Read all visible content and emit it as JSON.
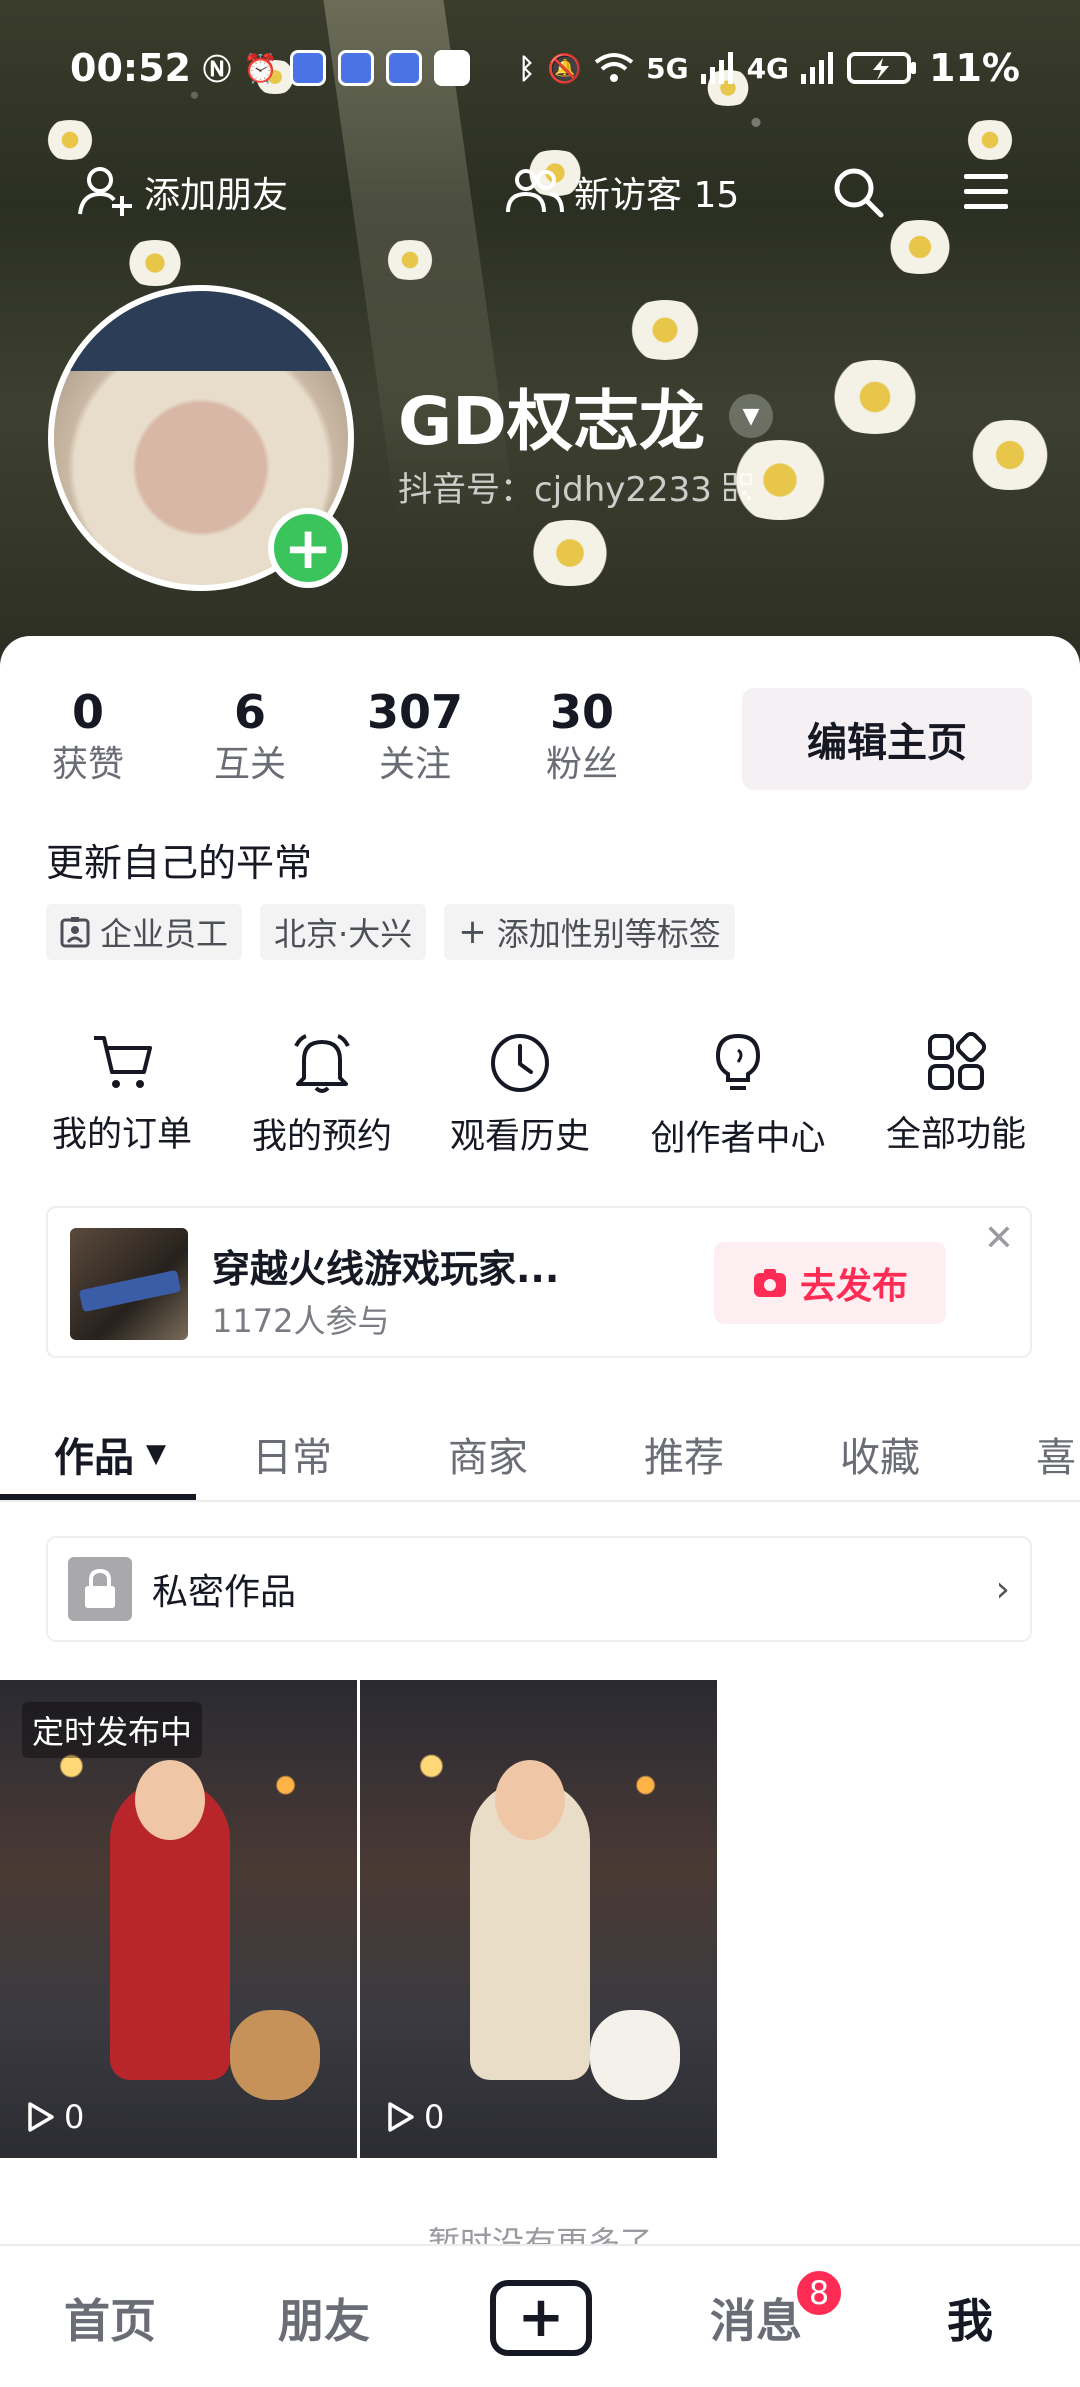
{
  "status_bar": {
    "time": "00:52",
    "network_5g": "5G",
    "network_4g": "4G",
    "battery": "11%"
  },
  "top_actions": {
    "add_friend": "添加朋友",
    "new_visitors": "新访客 15"
  },
  "profile": {
    "nickname": "GD权志龙",
    "douyin_id": "抖音号：cjdhy2233"
  },
  "stats": [
    {
      "value": "0",
      "label": "获赞"
    },
    {
      "value": "6",
      "label": "互关"
    },
    {
      "value": "307",
      "label": "关注"
    },
    {
      "value": "30",
      "label": "粉丝"
    }
  ],
  "edit_profile": "编辑主页",
  "bio": "更新自己的平常",
  "tags": [
    "企业员工",
    "北京·大兴",
    "添加性别等标签"
  ],
  "shortcuts": [
    {
      "label": "我的订单",
      "icon": "cart-icon"
    },
    {
      "label": "我的预约",
      "icon": "bell-icon"
    },
    {
      "label": "观看历史",
      "icon": "clock-icon"
    },
    {
      "label": "创作者中心",
      "icon": "bulb-icon"
    },
    {
      "label": "全部功能",
      "icon": "grid-icon"
    }
  ],
  "promo": {
    "title": "穿越火线游戏玩家...",
    "participants": "1172人参与",
    "button": "去发布"
  },
  "tabs": [
    "作品",
    "日常",
    "商家",
    "推荐",
    "收藏",
    "喜"
  ],
  "private_works": "私密作品",
  "posts": [
    {
      "badge": "定时发布中",
      "plays": "0"
    },
    {
      "badge": "",
      "plays": "0"
    }
  ],
  "no_more": "暂时没有更多了",
  "bottom_nav": {
    "home": "首页",
    "friends": "朋友",
    "messages": "消息",
    "messages_badge": "8",
    "me": "我"
  },
  "colors": {
    "accent": "#fe2c55",
    "green": "#3bc45b",
    "text": "#161823"
  }
}
